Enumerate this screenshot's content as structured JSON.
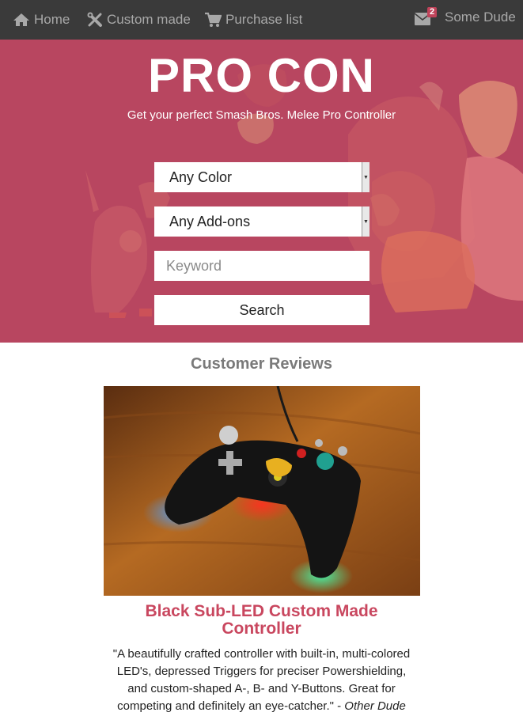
{
  "navbar": {
    "home": {
      "label": "Home",
      "icon": "home-icon"
    },
    "custom": {
      "label": "Custom made",
      "icon": "wrench-icon"
    },
    "purchase": {
      "label": "Purchase list",
      "icon": "cart-icon"
    },
    "user": {
      "name": "Some Dude",
      "icon": "envelope-icon",
      "unread_count": "2"
    }
  },
  "hero": {
    "title": "PRO CON",
    "subtitle": "Get your perfect Smash Bros. Melee Pro Controller",
    "color_select": "Any Color",
    "addon_select": "Any Add-ons",
    "keyword_placeholder": "Keyword",
    "search_label": "Search"
  },
  "reviews": {
    "heading": "Customer Reviews",
    "items": [
      {
        "title": "Black Sub-LED Custom Made Controller",
        "quote": "\"A beautifully crafted controller with built-in, multi-colored LED's, depressed Triggers for preciser Powershielding, and custom-shaped A-, B- and Y-Buttons. Great for competing and definitely an eye-catcher.\" - ",
        "author": "Other Dude"
      }
    ]
  },
  "colors": {
    "navbar_bg": "#3a3a3a",
    "hero_bg": "#b84660",
    "accent": "#c9475f"
  }
}
